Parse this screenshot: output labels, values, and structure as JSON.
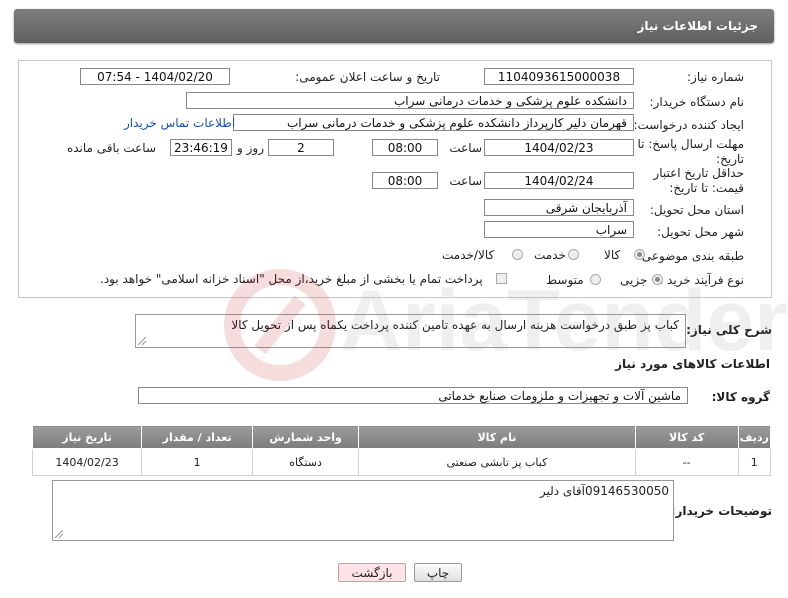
{
  "header": {
    "title": "جزئیات اطلاعات نیاز"
  },
  "form": {
    "need_number_label": "شماره نیاز:",
    "need_number": "1104093615000038",
    "announce_label": "تاریخ و ساعت اعلان عمومی:",
    "announce_value": "1404/02/20 - 07:54",
    "buyer_org_label": "نام دستگاه خریدار:",
    "buyer_org": "دانشکده علوم پزشکی و خدمات درمانی سراب",
    "creator_label": "ایجاد کننده درخواست:",
    "creator": "قهرمان دلیر کارپرداز دانشکده علوم پزشکی و خدمات درمانی سراب",
    "contact_link": "اطلاعات تماس خریدار",
    "deadline_label": "مهلت ارسال پاسخ: تا تاریخ:",
    "deadline_date": "1404/02/23",
    "time_label": "ساعت",
    "deadline_time": "08:00",
    "days_value": "2",
    "days_label": "روز و",
    "remaining_time": "23:46:19",
    "remaining_label": "ساعت باقی مانده",
    "validity_label": "حداقل تاریخ اعتبار قیمت: تا تاریخ:",
    "validity_date": "1404/02/24",
    "validity_time_label": "ساعت",
    "validity_time": "08:00",
    "province_label": "استان محل تحویل:",
    "province": "آذربایجان شرقی",
    "city_label": "شهر محل تحویل:",
    "city": "سراب",
    "category_label": "طبقه بندی موضوعی:",
    "category_options": [
      "کالا",
      "خدمت",
      "کالا/خدمت"
    ],
    "category_selected": "کالا",
    "process_label": "نوع فرآیند خرید :",
    "process_options": [
      "جزیی",
      "متوسط"
    ],
    "process_selected": "جزیی",
    "payment_note": "پرداخت تمام یا بخشی از مبلغ خرید،از محل \"اسناد خزانه اسلامی\" خواهد بود."
  },
  "description": {
    "label": "شرح کلی نیاز:",
    "text": "کباب پز طبق درخواست هزینه ارسال به عهده تامین کننده پرداخت یکماه پس از تحویل کالا"
  },
  "goods": {
    "section_title": "اطلاعات کالاهای مورد نیاز",
    "group_label": "گروه کالا:",
    "group_value": "ماشین آلات و تجهیزات و ملزومات صنایع خدماتی",
    "columns": [
      "ردیف",
      "کد کالا",
      "نام کالا",
      "واحد شمارش",
      "تعداد / مقدار",
      "تاریخ نیاز"
    ],
    "rows": [
      [
        "1",
        "--",
        "کباب پز تابشی صنعتی",
        "دستگاه",
        "1",
        "1404/02/23"
      ]
    ]
  },
  "buyer_notes": {
    "label": "توضیحات خریدار:",
    "text": "09146530050آقای دلیر"
  },
  "buttons": {
    "print": "چاپ",
    "back": "بازگشت"
  },
  "colors": {
    "header": "#6f6f6f",
    "link": "#1a4fb5",
    "back_button": "#fbe3e6"
  }
}
